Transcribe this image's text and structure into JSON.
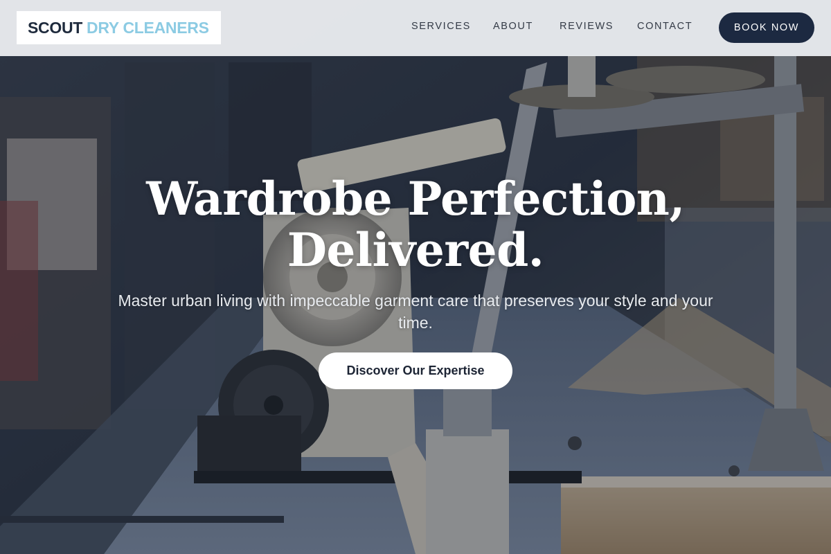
{
  "brand": {
    "name_part1": "SCOUT",
    "name_part2": "DRY CLEANERS",
    "colors": {
      "dark": "#1e2a3c",
      "accent": "#8ccbe3"
    }
  },
  "nav": {
    "items": [
      {
        "label": "SERVICES"
      },
      {
        "label": "ABOUT"
      },
      {
        "label": "REVIEWS"
      },
      {
        "label": "CONTACT"
      }
    ],
    "cta_label": "BOOK NOW"
  },
  "hero": {
    "title_line1": "Wardrobe Perfection,",
    "title_line2": "Delivered.",
    "subtitle": "Master urban living with impeccable garment care that preserves your style and your time.",
    "cta_label": "Discover Our Expertise",
    "background_subject": "industrial-sewing-machine-photo"
  }
}
